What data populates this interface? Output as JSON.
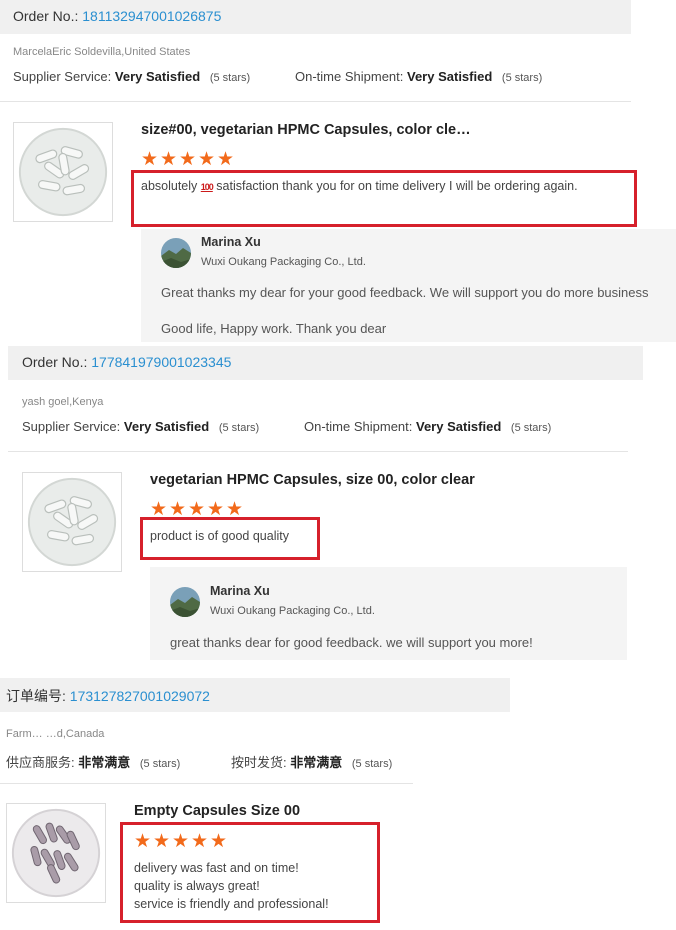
{
  "orders": [
    {
      "order_label": "Order No.:",
      "order_number": "181132947001026875",
      "buyer": "MarcelaEric Soldevilla,United States",
      "supplier_label": "Supplier Service:",
      "supplier_value": "Very Satisfied",
      "supplier_stars": "(5 stars)",
      "shipment_label": "On-time Shipment:",
      "shipment_value": "Very Satisfied",
      "shipment_stars": "(5 stars)",
      "product_title": "size#00, vegetarian HPMC Capsules, color cle…",
      "rating": 5,
      "review_before": "absolutely ",
      "review_emoji": "100",
      "review_after": " satisfaction thank you for on time delivery I will be ordering again.",
      "reply": {
        "seller": "Marina Xu",
        "company": "Wuxi Oukang Packaging Co., Ltd.",
        "lines": [
          "Great thanks my dear for your good feedback. We will support you do more business",
          "Good life, Happy work. Thank you dear"
        ]
      }
    },
    {
      "order_label": "Order No.:",
      "order_number": "177841979001023345",
      "buyer": "yash goel,Kenya",
      "supplier_label": "Supplier Service:",
      "supplier_value": "Very Satisfied",
      "supplier_stars": "(5 stars)",
      "shipment_label": "On-time Shipment:",
      "shipment_value": "Very Satisfied",
      "shipment_stars": "(5 stars)",
      "product_title": "vegetarian HPMC Capsules, size 00, color clear",
      "rating": 5,
      "review": "product is of good quality",
      "reply": {
        "seller": "Marina Xu",
        "company": "Wuxi Oukang Packaging Co., Ltd.",
        "lines": [
          "great thanks dear for good feedback. we will support you more!"
        ]
      }
    },
    {
      "order_label": "订单编号:",
      "order_number": "173127827001029072",
      "buyer": "Farm…  …d,Canada",
      "supplier_label": "供应商服务:",
      "supplier_value": "非常满意",
      "supplier_stars": "(5 stars)",
      "shipment_label": "按时发货:",
      "shipment_value": "非常满意",
      "shipment_stars": "(5 stars)",
      "product_title": "Empty  Capsules Size 00",
      "rating": 5,
      "review_lines": [
        "delivery was fast and on time!",
        "quality is always great!",
        "service is friendly and professional!"
      ]
    }
  ],
  "icons": {
    "star": "star-icon",
    "capsule_clear": "clear-capsules-photo",
    "capsule_silver": "silver-capsules-photo",
    "avatar": "seller-avatar"
  },
  "colors": {
    "link": "#2a8fd0",
    "star": "#f26a1b",
    "highlight": "#d6202b",
    "reply_bg": "#f4f4f4"
  }
}
